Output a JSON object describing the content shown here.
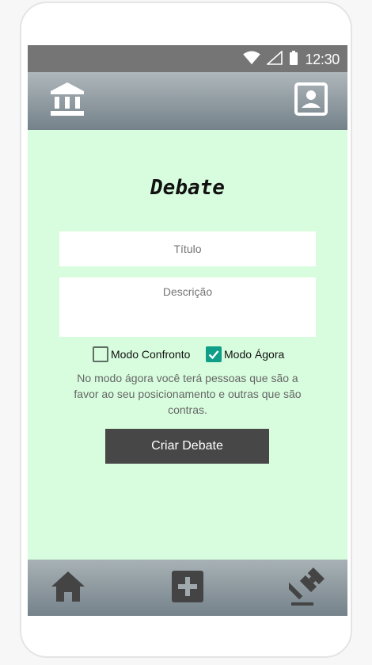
{
  "status_bar": {
    "time": "12:30",
    "icons": [
      "wifi-icon",
      "signal-icon",
      "battery-icon"
    ]
  },
  "app_bar": {
    "left_icon": "institution-icon",
    "right_icon": "profile-icon"
  },
  "form": {
    "title": "Debate",
    "title_placeholder": "Título",
    "description_placeholder": "Descrição",
    "modes": [
      {
        "label": "Modo Confronto",
        "checked": false
      },
      {
        "label": "Modo Ágora",
        "checked": true
      }
    ],
    "info_text": "No modo ágora você terá pessoas que são a favor ao seu posicionamento e outras que são contras.",
    "create_button": "Criar Debate"
  },
  "bottom_nav": {
    "items": [
      "home-icon",
      "add-icon",
      "gavel-icon"
    ]
  },
  "colors": {
    "background": "#d8fdde",
    "accent": "#0f9f88",
    "button": "#474747",
    "status_bar": "#757575"
  }
}
